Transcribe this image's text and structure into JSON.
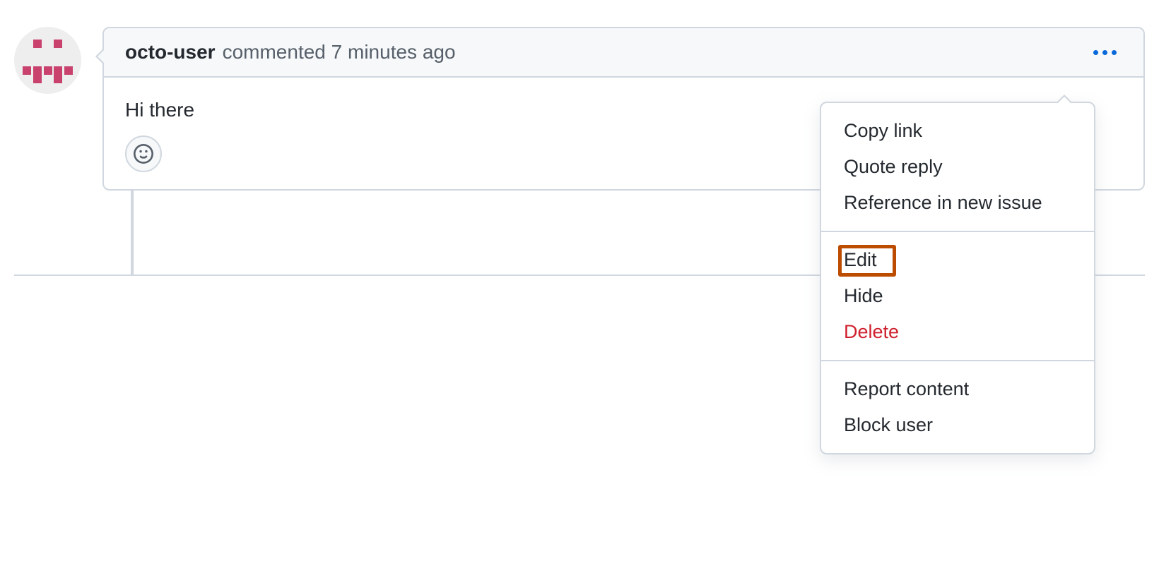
{
  "comment": {
    "author": "octo-user",
    "action_text": "commented",
    "timestamp": "7 minutes ago",
    "body": "Hi there"
  },
  "menu": {
    "section1": [
      {
        "label": "Copy link"
      },
      {
        "label": "Quote reply"
      },
      {
        "label": "Reference in new issue"
      }
    ],
    "section2": [
      {
        "label": "Edit",
        "highlighted": true
      },
      {
        "label": "Hide"
      },
      {
        "label": "Delete",
        "danger": true
      }
    ],
    "section3": [
      {
        "label": "Report content"
      },
      {
        "label": "Block user"
      }
    ]
  }
}
